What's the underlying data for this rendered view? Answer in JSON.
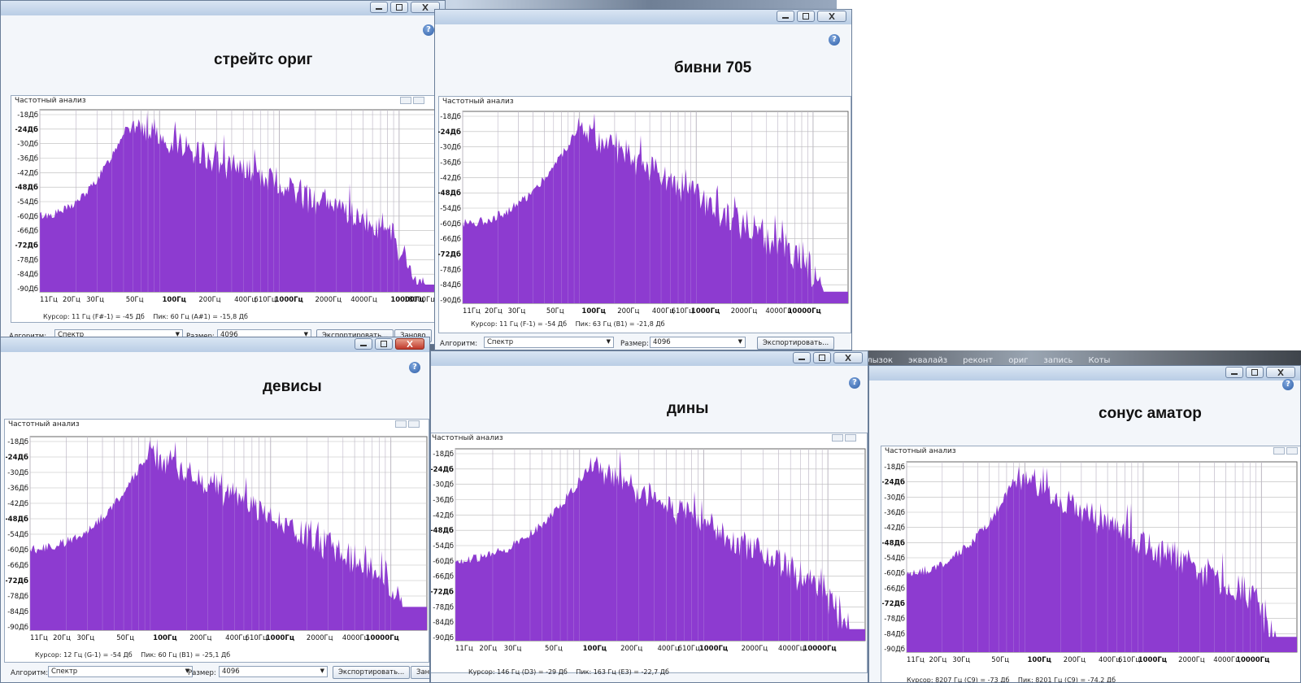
{
  "desktop": {
    "taskbar_items": [
      "глызок",
      "эквалайз",
      "реконт",
      "ориг",
      "запись",
      "Коты"
    ]
  },
  "common": {
    "panel_title": "Частотный анализ",
    "algorithm_label": "Алгоритм:",
    "algorithm_value": "Спектр",
    "size_label": "Размер:",
    "size_value": "4096",
    "export_label": "Экспортировать...",
    "replay_label": "Заново",
    "help_glyph": "?",
    "db_ticks": [
      "-18Дб",
      "-24Дб",
      "-30Дб",
      "-36Дб",
      "-42Дб",
      "-48Дб",
      "-54Дб",
      "-60Дб",
      "-66Дб",
      "-72Дб",
      "-78Дб",
      "-84Дб",
      "-90Дб"
    ],
    "fill_color": "#8d3bd0",
    "grid_color": "#b9b9b9"
  },
  "windows": [
    {
      "id": "w1",
      "caption": "стрейтс ориг",
      "cursor": "Курсор: 11 Гц (F#-1) = -45 Дб",
      "peak": "Пик: 60 Гц (A#1) = -15,8 Дб",
      "freq_ticks": [
        "11Гц",
        "20Гц",
        "30Гц",
        "50Гц",
        "100Гц",
        "200Гц",
        "400Гц",
        "610Гц",
        "1000Гц",
        "2000Гц",
        "4000Гц",
        "10000Гц",
        "18000Гц"
      ]
    },
    {
      "id": "w2",
      "caption": "бивни 705",
      "cursor": "Курсор: 11 Гц (F-1) = -54 Дб",
      "peak": "Пик: 63 Гц (B1) = -21,8 Дб",
      "freq_ticks": [
        "11Гц",
        "20Гц",
        "30Гц",
        "50Гц",
        "100Гц",
        "200Гц",
        "400Гц",
        "610Гц",
        "1000Гц",
        "2000Гц",
        "4000Гц",
        "10000Гц"
      ]
    },
    {
      "id": "w3",
      "caption": "девисы",
      "cursor": "Курсор: 12 Гц (G-1) = -54 Дб",
      "peak": "Пик: 60 Гц (B1) = -25,1 Дб",
      "freq_ticks": [
        "11Гц",
        "20Гц",
        "30Гц",
        "50Гц",
        "100Гц",
        "200Гц",
        "400Гц",
        "610Гц",
        "1000Гц",
        "2000Гц",
        "4000Гц",
        "10000Гц"
      ]
    },
    {
      "id": "w4",
      "caption": "дины",
      "cursor": "Курсор: 146 Гц (D3) = -29 Дб",
      "peak": "Пик: 163 Гц (E3) = -22,7 Дб",
      "freq_ticks": [
        "11Гц",
        "20Гц",
        "30Гц",
        "50Гц",
        "100Гц",
        "200Гц",
        "400Гц",
        "610Гц",
        "1000Гц",
        "2000Гц",
        "4000Гц",
        "10000Гц"
      ]
    },
    {
      "id": "w5",
      "caption": "сонус аматор",
      "cursor": "Курсор: 8207 Гц (C9) = -73 Дб",
      "peak": "Пик: 8201 Гц (C9) = -74,2 Дб",
      "freq_ticks": [
        "11Гц",
        "20Гц",
        "30Гц",
        "50Гц",
        "100Гц",
        "200Гц",
        "400Гц",
        "610Гц",
        "1000Гц",
        "2000Гц",
        "4000Гц",
        "10000Гц"
      ]
    }
  ]
}
